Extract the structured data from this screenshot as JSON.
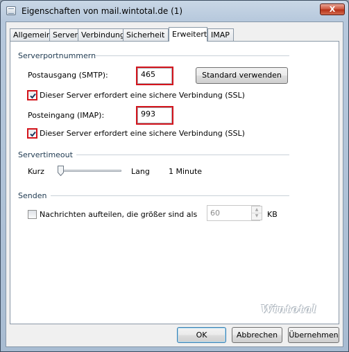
{
  "window": {
    "title": "Eigenschaften von mail.wintotal.de (1)",
    "close_glyph": "X"
  },
  "tabs": [
    {
      "label": "Allgemein"
    },
    {
      "label": "Server"
    },
    {
      "label": "Verbindung"
    },
    {
      "label": "Sicherheit"
    },
    {
      "label": "Erweitert"
    },
    {
      "label": "IMAP"
    }
  ],
  "active_tab": "Erweitert",
  "serverports": {
    "group_title": "Serverportnummern",
    "smtp_label": "Postausgang (SMTP):",
    "smtp_value": "465",
    "standard_button": "Standard verwenden",
    "smtp_ssl_label": "Dieser Server erfordert eine sichere Verbindung (SSL)",
    "smtp_ssl_checked": true,
    "imap_label": "Posteingang (IMAP):",
    "imap_value": "993",
    "imap_ssl_label": "Dieser Server erfordert eine sichere Verbindung (SSL)",
    "imap_ssl_checked": true
  },
  "timeout": {
    "group_title": "Servertimeout",
    "short_label": "Kurz",
    "long_label": "Lang",
    "value_text": "1 Minute",
    "slider_fraction": 0.05
  },
  "send": {
    "group_title": "Senden",
    "split_label": "Nachrichten aufteilen, die größer sind als",
    "split_checked": false,
    "size_value": "60",
    "unit": "KB"
  },
  "watermark": "Wintotal",
  "buttons": {
    "ok": "OK",
    "cancel": "Abbrechen",
    "apply": "Übernehmen"
  },
  "colors": {
    "highlight": "#d4141c",
    "check": "#1c3a60"
  }
}
